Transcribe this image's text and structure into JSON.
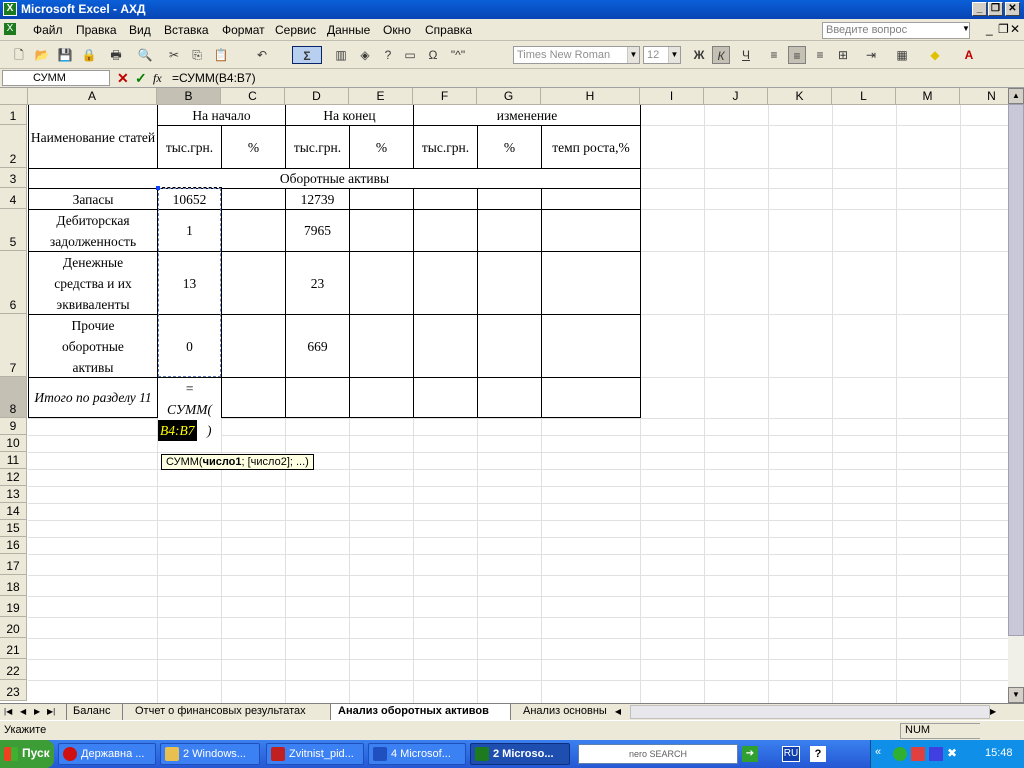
{
  "window": {
    "title": "Microsoft Excel - АХД"
  },
  "menu": [
    "Файл",
    "Правка",
    "Вид",
    "Вставка",
    "Формат",
    "Сервис",
    "Данные",
    "Окно",
    "Справка"
  ],
  "ask_placeholder": "Введите вопрос",
  "toolbar": {
    "font_name": "Times New Roman",
    "font_size": "12",
    "sigma": "Σ",
    "bold": "Ж",
    "italic": "К",
    "underline": "Ч",
    "quote_label": "\"^\""
  },
  "formula_bar": {
    "name_box": "СУММ",
    "fx": "fx",
    "formula": "=СУММ(B4:B7)"
  },
  "columns": [
    "A",
    "B",
    "C",
    "D",
    "E",
    "F",
    "G",
    "H",
    "I",
    "J",
    "K",
    "L",
    "M",
    "N"
  ],
  "rows": [
    "1",
    "2",
    "3",
    "4",
    "5",
    "6",
    "7",
    "8",
    "9",
    "10",
    "11",
    "12",
    "13",
    "14",
    "15",
    "16",
    "17",
    "18",
    "19",
    "20",
    "21",
    "22",
    "23"
  ],
  "table": {
    "header_name": "Наименование статей",
    "start": "На начало",
    "end": "На конец",
    "change": "изменение",
    "unit_b": "тыс.грн.",
    "pct_c": "%",
    "unit_d": "тыс.грн.",
    "pct_e": "%",
    "unit_f": "тыс.грн.",
    "pct_g": "%",
    "growth": "темп роста,%",
    "section": "Оборотные активы",
    "r4_name": "Запасы",
    "r4_b": "10652",
    "r4_d": "12739",
    "r5_name": "Дебиторская задолженность",
    "r5_b": "1",
    "r5_d": "7965",
    "r6_name": "Денежные средства и их эквиваленты",
    "r6_b": "13",
    "r6_d": "23",
    "r7_name": "Прочие оборотные активы",
    "r7_b": "0",
    "r7_d": "669",
    "r8_name": "Итого по разделу 11",
    "r8_b_line1": "=",
    "r8_b_line2": "СУММ(",
    "r8_b_ref": "B4:B7",
    "r8_b_close": ")"
  },
  "tooltip": {
    "prefix": "СУММ(",
    "arg1": "число1",
    "rest": "; [число2]; ...)"
  },
  "sheets": [
    "Баланс",
    "Отчет о финансовых результатах",
    "Анализ оборотных активов",
    "Анализ основны"
  ],
  "active_sheet": "Анализ оборотных активов",
  "status": {
    "mode": "Укажите",
    "num": "NUM"
  },
  "taskbar": {
    "start": "Пуск",
    "tasks": [
      "Державна ...",
      "2 Windows...",
      "Zvitnist_pid...",
      "4 Microsof...",
      "2 Microso..."
    ],
    "search": "nero SEARCH",
    "lang": "RU",
    "time": "15:48"
  },
  "colors": {
    "title": "#0a5fd8",
    "taskbar": "#2558d4",
    "start": "#3c9c35",
    "selection_dash": "#000000"
  }
}
